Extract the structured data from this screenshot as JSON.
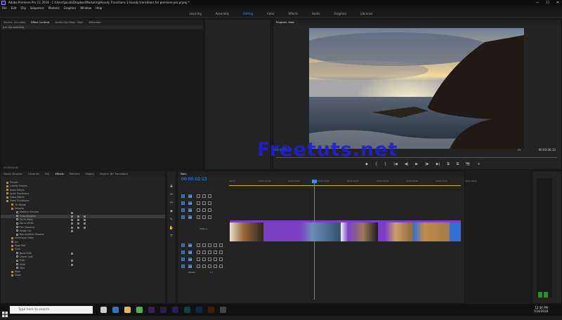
{
  "window": {
    "title": "Adobe Premiere Pro CC 2018 - C:\\Users\\Jacob\\Dropbox\\Marketing\\Handy Transitions 1-Handy transitions for premiere pro.prproj *",
    "controls": [
      "—",
      "☐",
      "✕"
    ]
  },
  "menu": [
    "File",
    "Edit",
    "Clip",
    "Sequence",
    "Markers",
    "Graphics",
    "Window",
    "Help"
  ],
  "workspaces": [
    {
      "label": "Learning",
      "active": false
    },
    {
      "label": "Assembly",
      "active": false
    },
    {
      "label": "Editing",
      "active": true
    },
    {
      "label": "Color",
      "active": false
    },
    {
      "label": "Effects",
      "active": false
    },
    {
      "label": "Audio",
      "active": false
    },
    {
      "label": "Graphics",
      "active": false
    },
    {
      "label": "Libraries",
      "active": false
    }
  ],
  "source_panel": {
    "tabs": [
      "Source: (no clips)",
      "Effect Controls",
      "Audio Clip Mixer: Main",
      "Metadata"
    ],
    "active_tab": "Effect Controls",
    "message": "(no clip selected)",
    "timecode": "00:00:00:00"
  },
  "program_panel": {
    "tab": "Program: Main",
    "timecode_left": "00:00:02:13",
    "zoom": "Fit",
    "quality": "1/2",
    "timecode_right": "00:00:06:12",
    "controls": [
      "◆",
      "{",
      "}",
      "|◀",
      "◀|",
      "▶",
      "|▶",
      "▶|",
      "⧉",
      "⧉",
      "📷",
      "+"
    ]
  },
  "watermark": "Freetuts.net",
  "effects_panel": {
    "tabs": [
      "Handy Browser",
      "Libraries",
      "Info",
      "Effects",
      "Markers",
      "History",
      "Project: HH Transitions"
    ],
    "active_tab": "Effects",
    "tree": [
      {
        "label": "Presets",
        "kind": "folder",
        "indent": 0
      },
      {
        "label": "Lumetri Presets",
        "kind": "folder",
        "indent": 0
      },
      {
        "label": "Audio Effects",
        "kind": "folder",
        "indent": 0
      },
      {
        "label": "Audio Transitions",
        "kind": "folder",
        "indent": 0
      },
      {
        "label": "Video Effects",
        "kind": "folder",
        "indent": 0
      },
      {
        "label": "Video Transitions",
        "kind": "folder",
        "indent": 0
      },
      {
        "label": "3D Motion",
        "kind": "folder",
        "indent": 1
      },
      {
        "label": "Dissolve",
        "kind": "folder",
        "indent": 1
      },
      {
        "label": "Additive Dissolve",
        "kind": "fx",
        "indent": 2,
        "badges": 1
      },
      {
        "label": "Cross Dissolve",
        "kind": "fx",
        "indent": 2,
        "badges": 3,
        "selected": true
      },
      {
        "label": "Dip to Black",
        "kind": "fx",
        "indent": 2,
        "badges": 3
      },
      {
        "label": "Dip to White",
        "kind": "fx",
        "indent": 2,
        "badges": 3
      },
      {
        "label": "Film Dissolve",
        "kind": "fx",
        "indent": 2,
        "badges": 3
      },
      {
        "label": "Morph Cut",
        "kind": "fx",
        "indent": 2,
        "badges": 1
      },
      {
        "label": "Non-Additive Dissolve",
        "kind": "fx",
        "indent": 2,
        "badges": 0
      },
      {
        "label": "Immersive Video",
        "kind": "folder",
        "indent": 1
      },
      {
        "label": "Iris",
        "kind": "folder",
        "indent": 1
      },
      {
        "label": "Page Peel",
        "kind": "folder",
        "indent": 1
      },
      {
        "label": "Slide",
        "kind": "folder",
        "indent": 1
      },
      {
        "label": "Band Slide",
        "kind": "fx",
        "indent": 2,
        "badges": 1
      },
      {
        "label": "Center Split",
        "kind": "fx",
        "indent": 2,
        "badges": 0
      },
      {
        "label": "Push",
        "kind": "fx",
        "indent": 2,
        "badges": 1
      },
      {
        "label": "Slide",
        "kind": "fx",
        "indent": 2,
        "badges": 1
      },
      {
        "label": "Split",
        "kind": "fx",
        "indent": 2,
        "badges": 0
      },
      {
        "label": "Wipe",
        "kind": "folder",
        "indent": 1
      },
      {
        "label": "Zoom",
        "kind": "folder",
        "indent": 1
      }
    ]
  },
  "tools": [
    "▲",
    "⇹",
    "↔",
    "◆",
    "✎",
    "✋",
    "T"
  ],
  "timeline": {
    "tab": "Main",
    "timecode": "00:00:02:13",
    "ruler": [
      ":00:00",
      "00:00:01:00",
      "00:00:02:00",
      "00:00:03:00",
      "00:00:04:00",
      "00:00:05:00",
      "00:00:06:00",
      "00:00:07:00",
      "00:00:08:00"
    ],
    "video_tracks": [
      "V4",
      "V3",
      "V2",
      "V1"
    ],
    "audio_tracks": [
      "A1",
      "A2",
      "A3",
      "A4"
    ],
    "track_name_v1": "Video 1",
    "master_label": "Master",
    "master_value": "0.0"
  },
  "taskbar": {
    "search_placeholder": "Type here to search",
    "time": "12:36 PM",
    "date": "7/24/2018"
  },
  "colors": {
    "accent": "#3b8cff",
    "workarea": "#c9b71f",
    "clip_purple": "#7b3fc6",
    "clip_blue": "#2e6ed6",
    "watermark": "#1f1fdc"
  }
}
